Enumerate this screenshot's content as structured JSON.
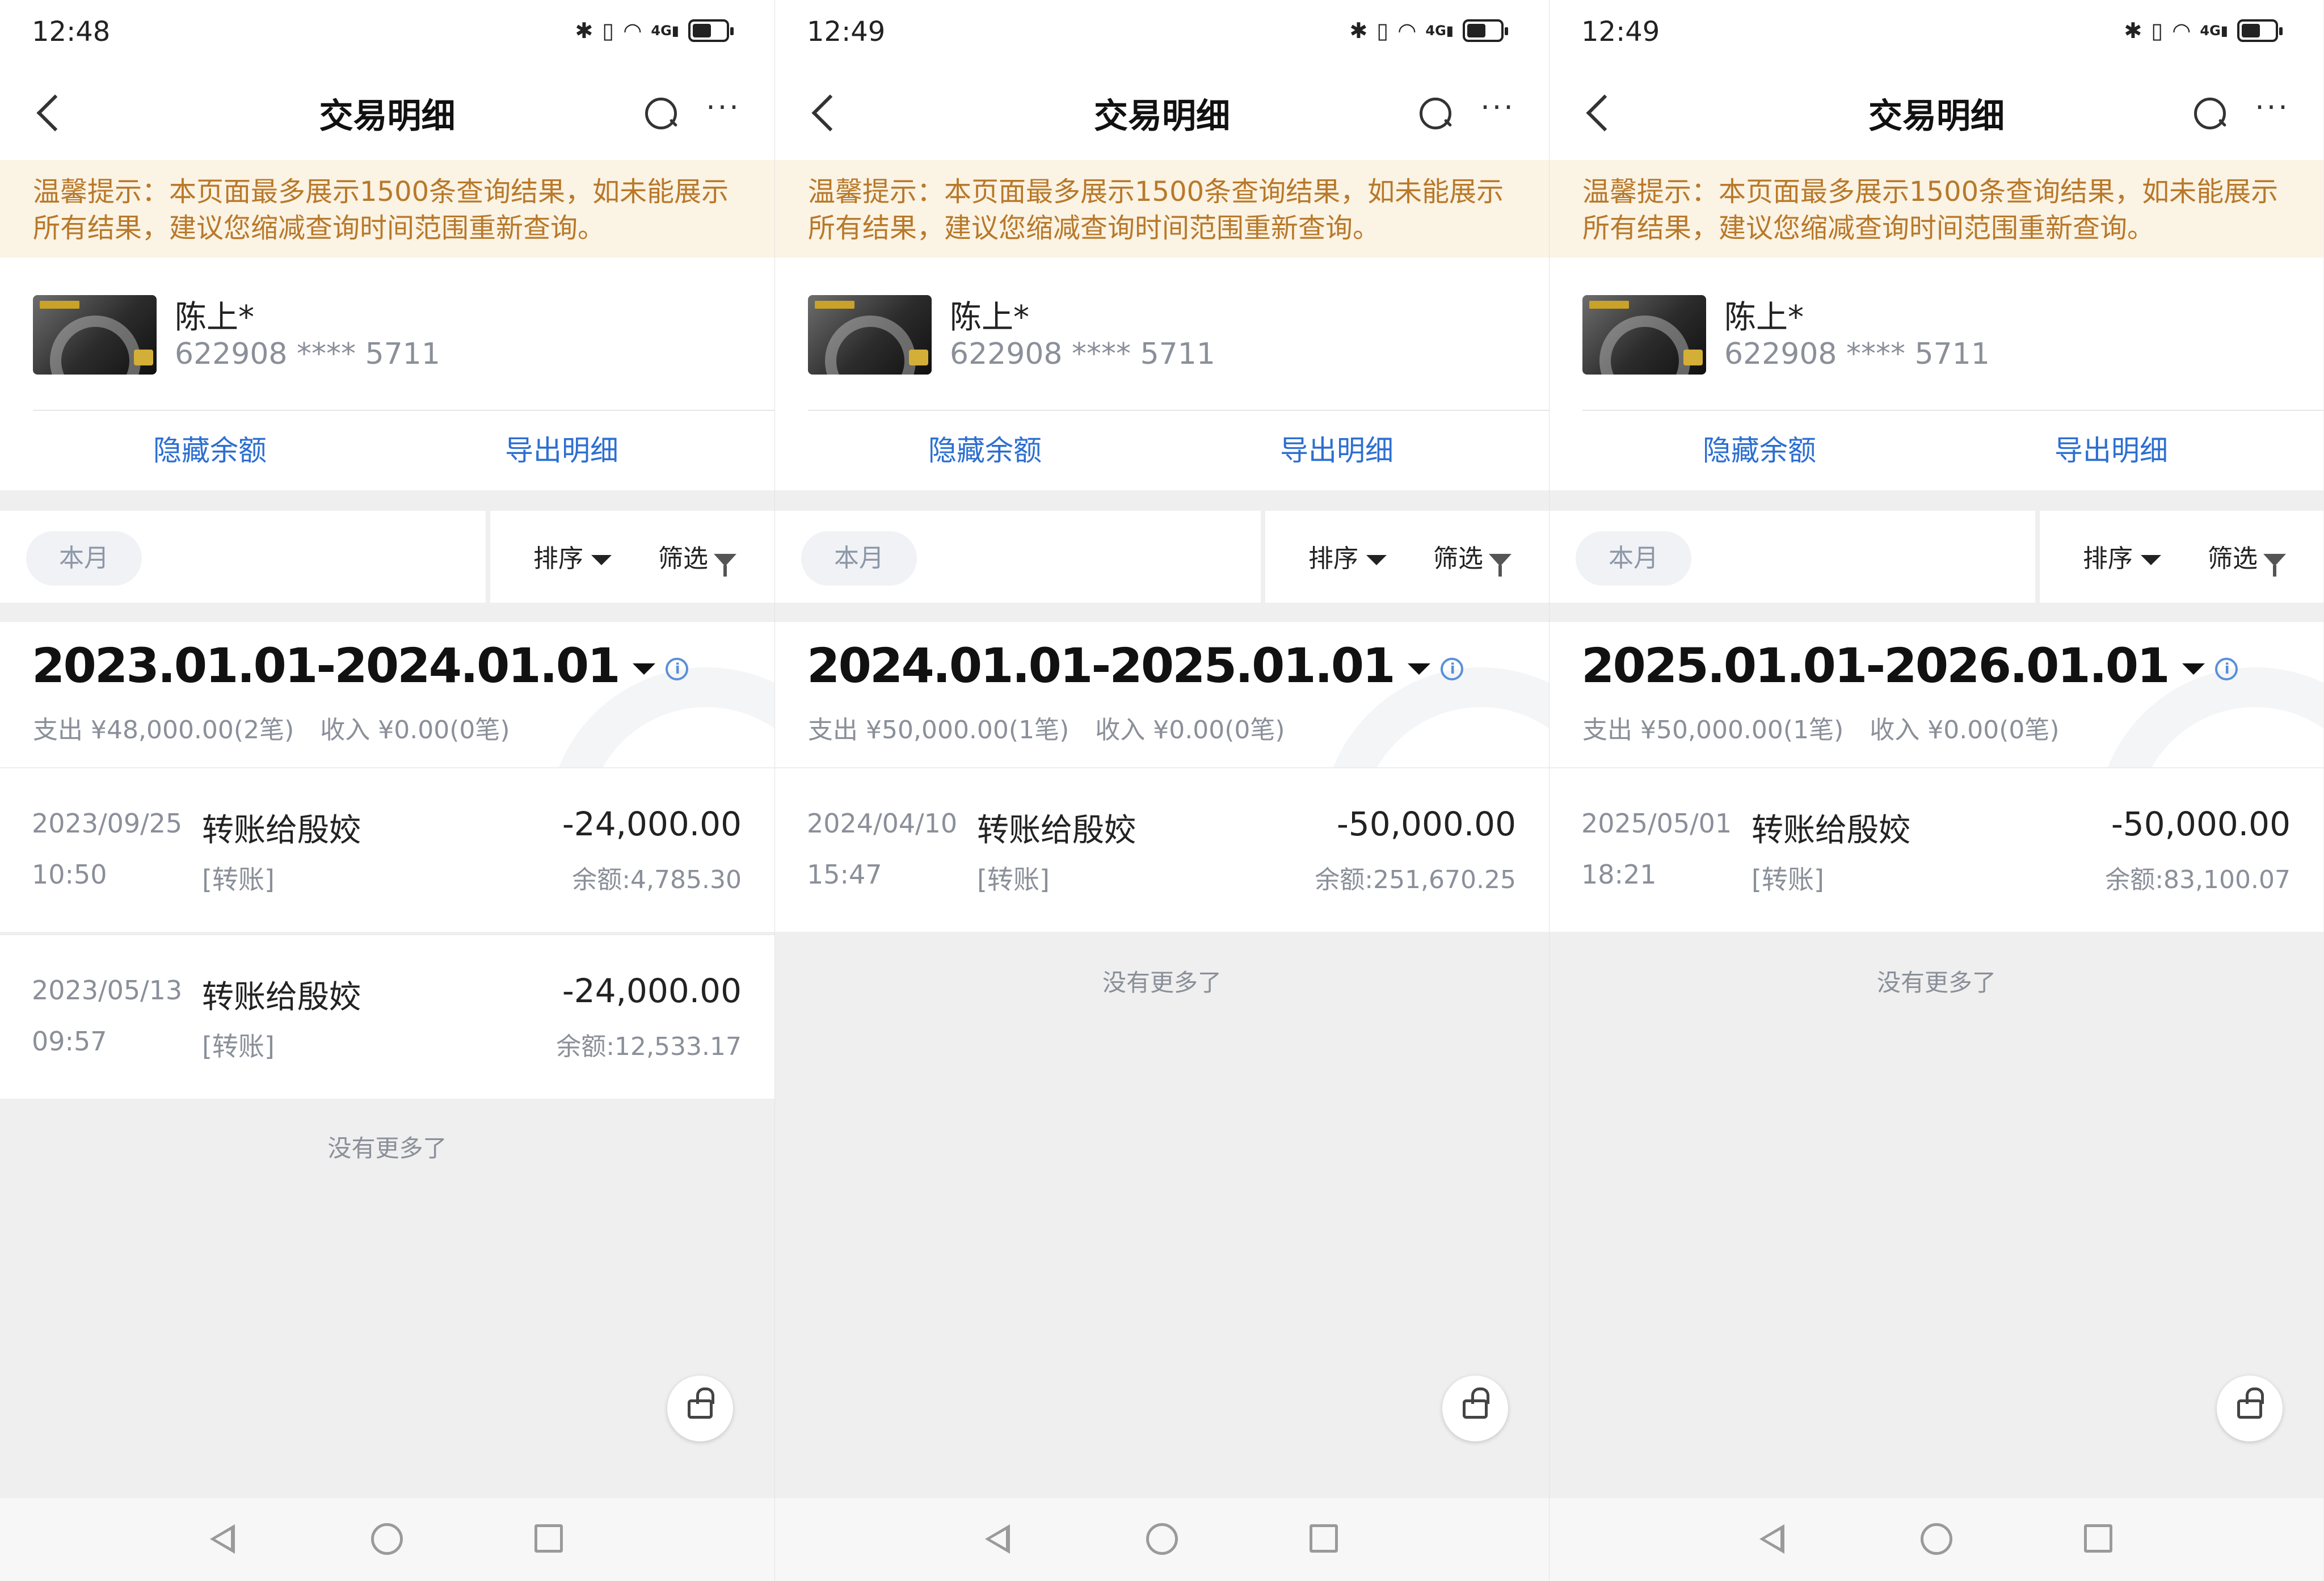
{
  "screens": [
    {
      "status": {
        "time": "12:48"
      },
      "nav": {
        "title": "交易明细"
      },
      "notice": "温馨提示：本页面最多展示1500条查询结果，如未能展示所有结果，建议您缩减查询时间范围重新查询。",
      "account": {
        "name": "陈上*",
        "number": "622908 **** 5711",
        "hide_balance": "隐藏余额",
        "export": "导出明细"
      },
      "filter": {
        "month": "本月",
        "sort": "排序",
        "filter": "筛选"
      },
      "summary": {
        "range": "2023.01.01-2024.01.01",
        "expense": "支出 ¥48,000.00(2笔)",
        "income": "收入 ¥0.00(0笔)"
      },
      "transactions": [
        {
          "date": "2023/09/25",
          "time": "10:50",
          "title": "转账给殷姣",
          "type": "[转账]",
          "amount": "-24,000.00",
          "balance": "余额:4,785.30"
        },
        {
          "date": "2023/05/13",
          "time": "09:57",
          "title": "转账给殷姣",
          "type": "[转账]",
          "amount": "-24,000.00",
          "balance": "余额:12,533.17"
        }
      ],
      "no_more": "没有更多了"
    },
    {
      "status": {
        "time": "12:49"
      },
      "nav": {
        "title": "交易明细"
      },
      "notice": "温馨提示：本页面最多展示1500条查询结果，如未能展示所有结果，建议您缩减查询时间范围重新查询。",
      "account": {
        "name": "陈上*",
        "number": "622908 **** 5711",
        "hide_balance": "隐藏余额",
        "export": "导出明细"
      },
      "filter": {
        "month": "本月",
        "sort": "排序",
        "filter": "筛选"
      },
      "summary": {
        "range": "2024.01.01-2025.01.01",
        "expense": "支出 ¥50,000.00(1笔)",
        "income": "收入 ¥0.00(0笔)"
      },
      "transactions": [
        {
          "date": "2024/04/10",
          "time": "15:47",
          "title": "转账给殷姣",
          "type": "[转账]",
          "amount": "-50,000.00",
          "balance": "余额:251,670.25"
        }
      ],
      "no_more": "没有更多了"
    },
    {
      "status": {
        "time": "12:49"
      },
      "nav": {
        "title": "交易明细"
      },
      "notice": "温馨提示：本页面最多展示1500条查询结果，如未能展示所有结果，建议您缩减查询时间范围重新查询。",
      "account": {
        "name": "陈上*",
        "number": "622908 **** 5711",
        "hide_balance": "隐藏余额",
        "export": "导出明细"
      },
      "filter": {
        "month": "本月",
        "sort": "排序",
        "filter": "筛选"
      },
      "summary": {
        "range": "2025.01.01-2026.01.01",
        "expense": "支出 ¥50,000.00(1笔)",
        "income": "收入 ¥0.00(0笔)"
      },
      "transactions": [
        {
          "date": "2025/05/01",
          "time": "18:21",
          "title": "转账给殷姣",
          "type": "[转账]",
          "amount": "-50,000.00",
          "balance": "余额:83,100.07"
        }
      ],
      "no_more": "没有更多了"
    }
  ],
  "icons": {
    "status": [
      "bluetooth-icon",
      "vibrate-icon",
      "wifi-icon",
      "signal-4g-icon",
      "battery-icon"
    ],
    "nav": [
      "back-icon",
      "search-icon",
      "more-icon"
    ],
    "filter": [
      "sort-caret-icon",
      "funnel-icon"
    ],
    "summary": [
      "range-caret-icon",
      "info-icon"
    ],
    "float": "lock-icon",
    "system_nav": [
      "nav-back-icon",
      "nav-home-icon",
      "nav-recent-icon"
    ]
  },
  "colors": {
    "notice_bg": "#fbf3e4",
    "notice_text": "#b8792a",
    "link_blue": "#2d6fd1",
    "muted": "#8a8f99",
    "page_bg": "#efefef"
  }
}
